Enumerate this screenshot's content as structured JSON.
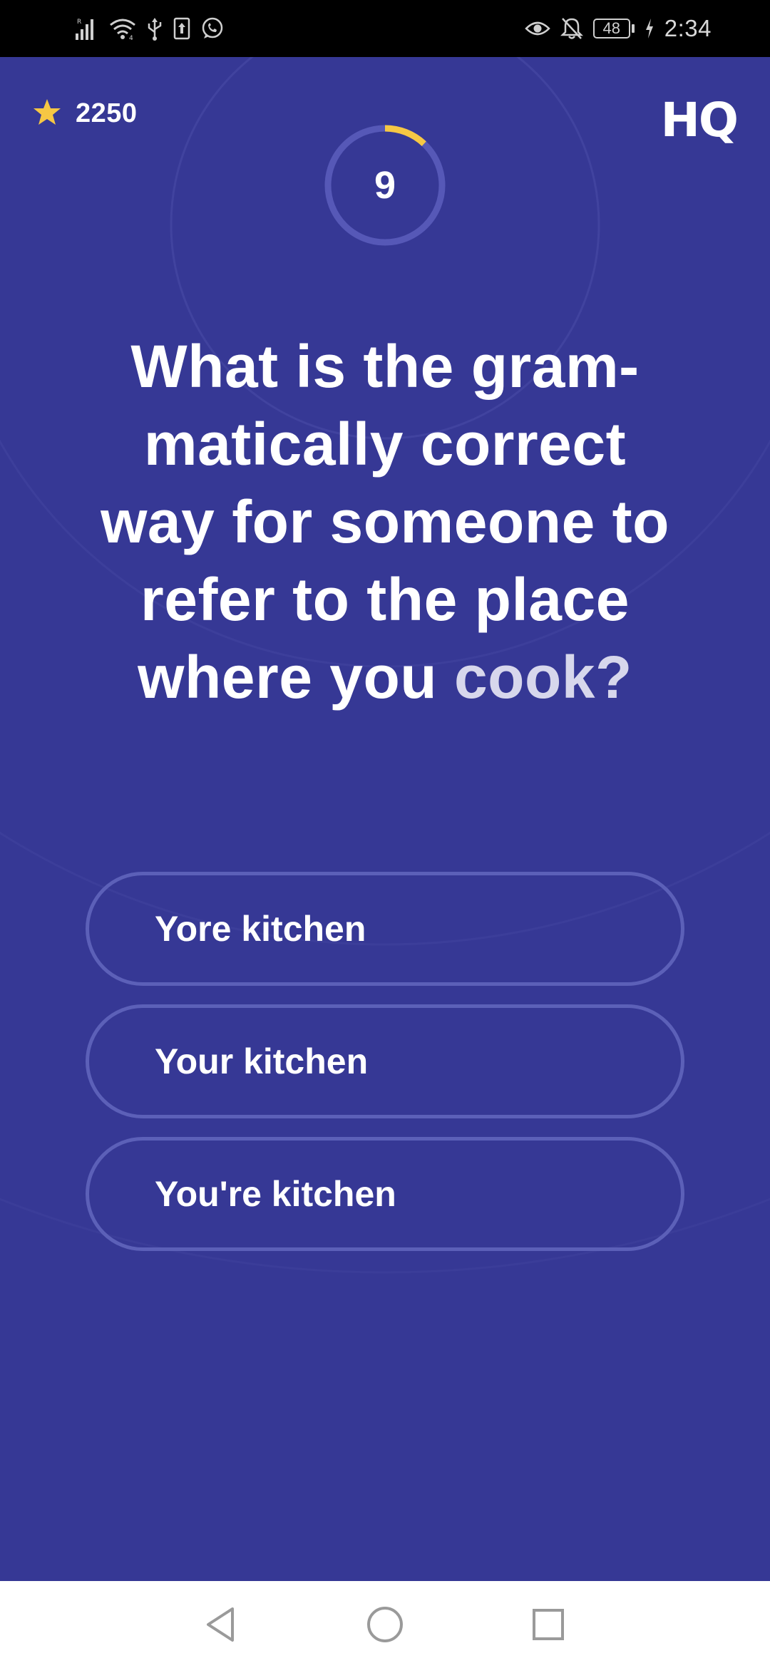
{
  "status_bar": {
    "time": "2:34",
    "battery_level": "48",
    "network_indicator": "R",
    "wifi_indicator": "4",
    "icons": [
      "signal-icon",
      "wifi-icon",
      "usb-icon",
      "upload-icon",
      "whatsapp-icon",
      "eye-icon",
      "bell-off-icon",
      "battery-icon",
      "charging-icon"
    ]
  },
  "header": {
    "score": "2250",
    "logo": "HQ",
    "star_color": "#f6c744"
  },
  "timer": {
    "seconds": "9",
    "progress_fraction": 0.12,
    "progress_color": "#f6c744"
  },
  "question": {
    "text_line1": "What is the gram-",
    "text_line2": "matically correct",
    "text_line3": "way for someone to",
    "text_line4": "refer to the place",
    "text_line5a": "where you ",
    "text_line5b": "cook?"
  },
  "answers": [
    {
      "label": "Yore kitchen"
    },
    {
      "label": "Your kitchen"
    },
    {
      "label": "You're kitchen"
    }
  ],
  "colors": {
    "background": "#363895",
    "answer_border": "#5c60b8"
  },
  "nav_bar": {
    "icons": [
      "back-icon",
      "home-icon",
      "recents-icon"
    ]
  }
}
